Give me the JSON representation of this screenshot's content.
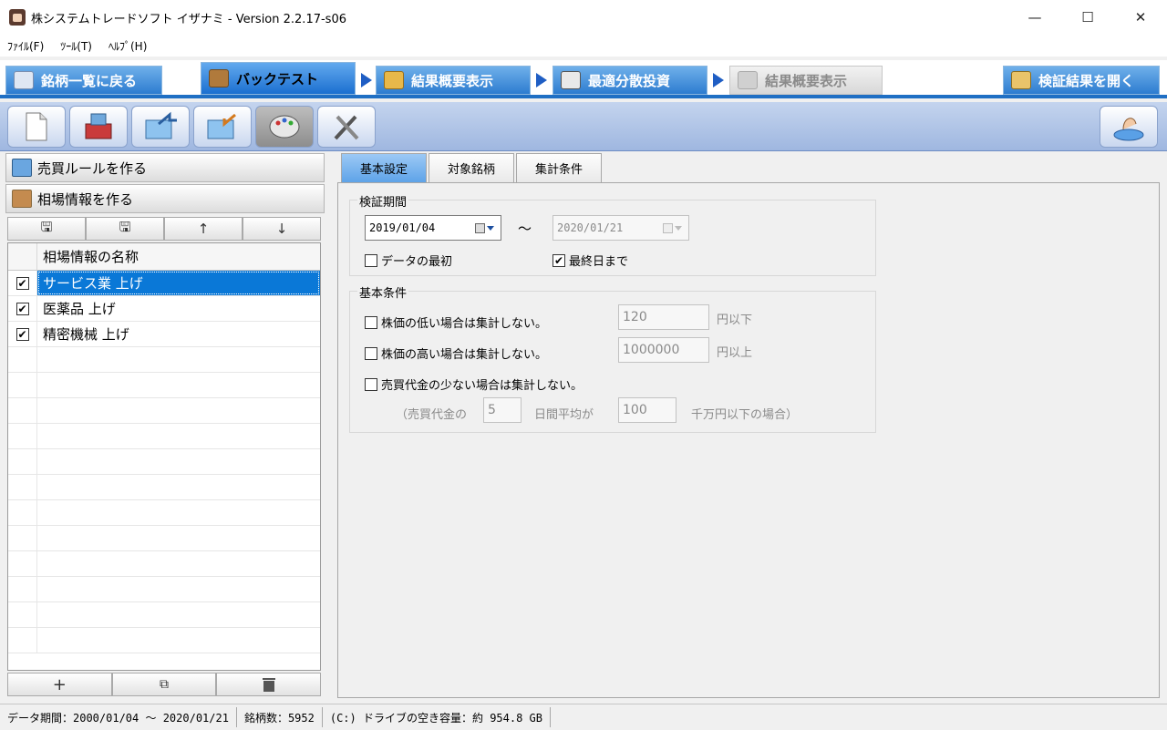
{
  "window": {
    "title": "株システムトレードソフト イザナミ - Version 2.2.17-s06",
    "minimize": "—",
    "maximize": "☐",
    "close": "✕"
  },
  "menu": [
    "ﾌｧｲﾙ(F)",
    "ﾂｰﾙ(T)",
    "ﾍﾙﾌﾟ(H)"
  ],
  "big_tabs": {
    "back": "銘柄一覧に戻る",
    "backtest": "バックテスト",
    "summary1": "結果概要表示",
    "optimal": "最適分散投資",
    "summary2": "結果概要表示",
    "open_results": "検証結果を開く"
  },
  "toolbar_icons": [
    "new-document-icon",
    "save-to-box-icon",
    "export-icon",
    "import-icon",
    "palette-icon",
    "tools-icon",
    "run-backtest-icon"
  ],
  "left_panel": {
    "make_rules": "売買ルールを作る",
    "make_market_info": "相場情報を作る",
    "column_header": "相場情報の名称",
    "rows": [
      {
        "checked": true,
        "name": "サービス業 上げ",
        "selected": true
      },
      {
        "checked": true,
        "name": "医薬品 上げ",
        "selected": false
      },
      {
        "checked": true,
        "name": "精密機械 上げ",
        "selected": false
      }
    ],
    "top_buttons": [
      "save-icon",
      "save-as-icon",
      "up-arrow-icon",
      "down-arrow-icon"
    ],
    "bottom_buttons": [
      "add-icon",
      "copy-icon",
      "trash-icon"
    ]
  },
  "right_panel": {
    "tabs": [
      "基本設定",
      "対象銘柄",
      "集計条件"
    ],
    "period": {
      "legend": "検証期間",
      "start": "2019/01/04",
      "tilde": "〜",
      "end": "2020/01/21",
      "from_first": "データの最初",
      "from_first_checked": false,
      "to_last": "最終日まで",
      "to_last_checked": true
    },
    "conditions": {
      "legend": "基本条件",
      "low_price_label": "株価の低い場合は集計しない。",
      "low_price_value": "120",
      "low_price_unit": "円以下",
      "high_price_label": "株価の高い場合は集計しない。",
      "high_price_value": "1000000",
      "high_price_unit": "円以上",
      "low_volume_label": "売買代金の少ない場合は集計しない。",
      "volume_prefix": "（売買代金の",
      "volume_days": "5",
      "volume_mid": "日間平均が",
      "volume_amount": "100",
      "volume_suffix": "千万円以下の場合）"
    }
  },
  "status": {
    "data_period": "データ期間：2000/01/04 〜 2020/01/21",
    "stock_count": "銘柄数：5952",
    "disk_free": "(C:) ドライブの空き容量：約 954.8 GB"
  }
}
